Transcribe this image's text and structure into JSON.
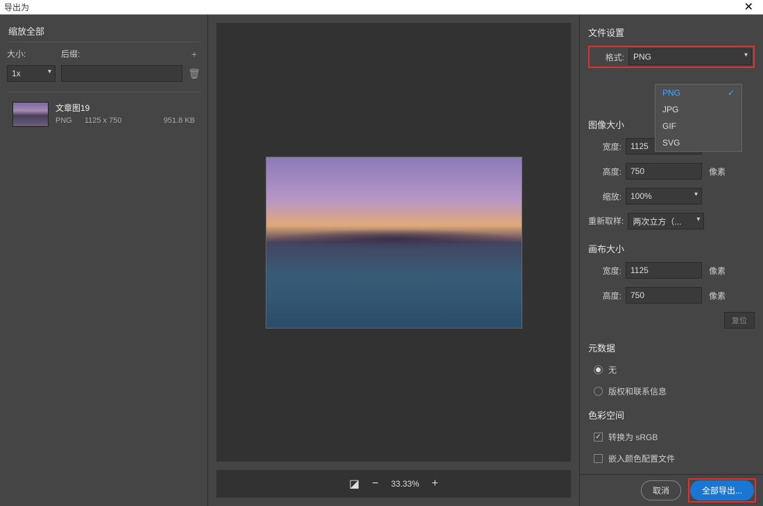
{
  "title": "导出为",
  "left": {
    "scale_all": "缩放全部",
    "size_label": "大小:",
    "suffix_label": "后缀:",
    "scale_value": "1x",
    "suffix_value": "",
    "asset": {
      "name": "文章图19",
      "format": "PNG",
      "dimensions": "1125 x 750",
      "filesize": "951.8 KB"
    }
  },
  "zoom": {
    "percent": "33.33%"
  },
  "right": {
    "file_settings": "文件设置",
    "format_label": "格式:",
    "format_value": "PNG",
    "format_options": [
      "PNG",
      "JPG",
      "GIF",
      "SVG"
    ],
    "image_size": "图像大小",
    "width_label": "宽度:",
    "height_label": "高度:",
    "scale_label": "缩放:",
    "resample_label": "重新取样:",
    "width_value": "1125",
    "height_value": "750",
    "scale_value": "100%",
    "resample_value": "两次立方（...",
    "pixel_unit": "像素",
    "canvas_size": "画布大小",
    "canvas_width": "1125",
    "canvas_height": "750",
    "reset": "复位",
    "metadata": "元数据",
    "meta_none": "无",
    "meta_copyright": "版权和联系信息",
    "colorspace": "色彩空间",
    "convert_srgb": "转换为 sRGB",
    "embed_profile": "嵌入颜色配置文件"
  },
  "footer": {
    "cancel": "取消",
    "export_all": "全部导出..."
  }
}
